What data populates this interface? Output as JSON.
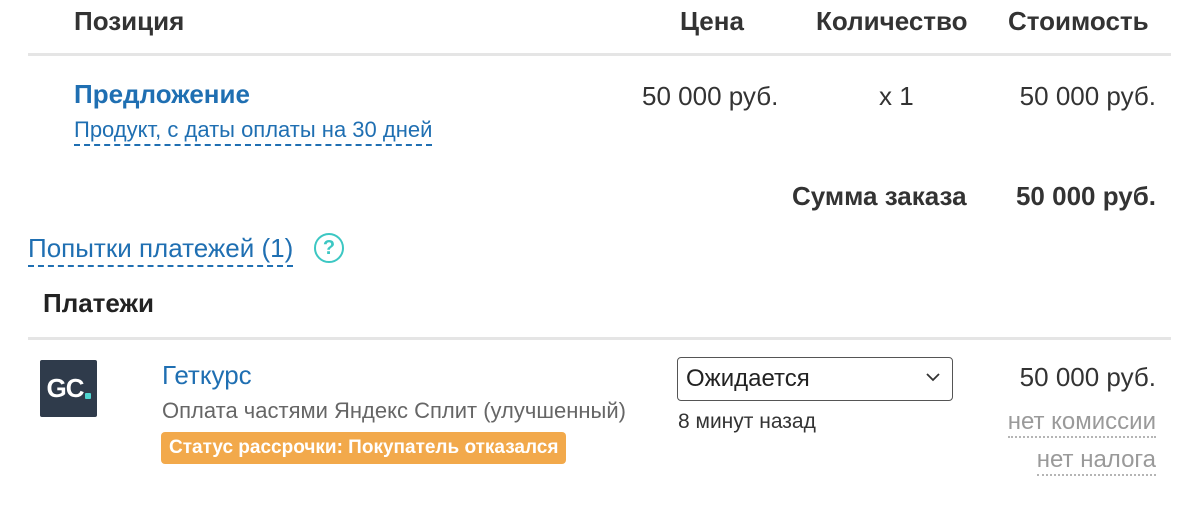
{
  "table": {
    "headers": {
      "position": "Позиция",
      "price": "Цена",
      "quantity": "Количество",
      "cost": "Стоимость"
    },
    "items": [
      {
        "name": "Предложение",
        "description": "Продукт, с даты оплаты на 30 дней",
        "price": "50 000 руб.",
        "quantity": "x 1",
        "cost": "50 000 руб."
      }
    ],
    "total": {
      "label": "Сумма заказа",
      "value": "50 000 руб."
    }
  },
  "attempts": {
    "label": "Попытки платежей (1)",
    "help_icon": "?"
  },
  "payments": {
    "title": "Платежи",
    "items": [
      {
        "logo": "GC",
        "name": "Геткурс",
        "method": "Оплата частями Яндекс Сплит (улучшенный)",
        "badge": "Статус рассрочки: Покупатель отказался",
        "status": "Ожидается",
        "time": "8 минут назад",
        "amount": "50 000 руб.",
        "commission": "нет комиссии",
        "tax": "нет налога"
      }
    ]
  },
  "colors": {
    "link": "#1f6fb2",
    "badge": "#f2a94b",
    "help": "#3cc7c3",
    "logo_bg": "#2f3b4b"
  }
}
